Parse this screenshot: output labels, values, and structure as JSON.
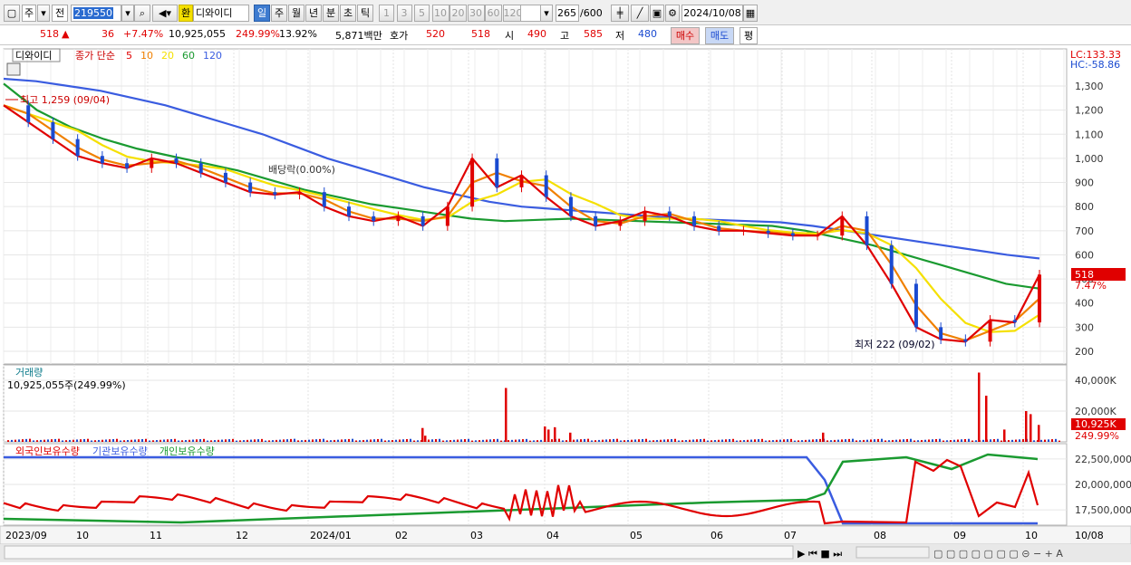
{
  "toolbar": {
    "market": "주",
    "market2": "전",
    "code": "219550",
    "stock_badge": "환",
    "stock_name": "디와이디",
    "periods": [
      "일",
      "주",
      "월",
      "년",
      "분",
      "초",
      "틱"
    ],
    "active_period": "일",
    "intervals": [
      "1",
      "3",
      "5",
      "10",
      "20",
      "30",
      "60",
      "120"
    ],
    "count": "265",
    "count_max": "/600",
    "date": "2024/10/08"
  },
  "quote": {
    "price": "518",
    "change_arrow": "▲",
    "change": "36",
    "change_pct": "+7.47%",
    "volume": "10,925,055",
    "volume_ratio": "249.99%",
    "turnover": "13.92%",
    "amount": "5,871백만",
    "bid_label": "호가",
    "bid1": "520",
    "bid2": "518",
    "open_label": "시",
    "open": "490",
    "high_label": "고",
    "high": "585",
    "low_label": "저",
    "low": "480",
    "buy_button": "매수",
    "sell_button": "매도",
    "eval_button": "평"
  },
  "price_panel": {
    "stock_label": "디와이디",
    "ma_label": "종가 단순",
    "ma_periods": [
      "5",
      "10",
      "20",
      "60",
      "120"
    ],
    "ma_colors": [
      "#e00000",
      "#f08000",
      "#f5e000",
      "#1a9a30",
      "#3a5ce0"
    ],
    "lc": "LC:133.33",
    "hc": "HC:-58.86",
    "high_annot": "최고 1,259 (09/04)",
    "low_annot": "최저 222 (09/02)",
    "dividend_annot": "배당락(0.00%)",
    "current_price": "518",
    "current_pct": "7.47%",
    "y_ticks": [
      "1,300",
      "1,200",
      "1,100",
      "1,000",
      "900",
      "800",
      "700",
      "600",
      "500",
      "400",
      "300",
      "200"
    ]
  },
  "volume_panel": {
    "title": "거래량",
    "value": "10,925,055주(249.99%)",
    "y_ticks": [
      "40,000K",
      "20,000K"
    ],
    "current": "10,925K",
    "current_pct": "249.99%"
  },
  "holdings_panel": {
    "legend": [
      "외국인보유수량",
      "기관보유수량",
      "개인보유수량"
    ],
    "colors": [
      "#e00000",
      "#3a5ce0",
      "#1a9a30"
    ],
    "y_ticks": [
      "22,500,000",
      "20,000,000",
      "17,500,000"
    ]
  },
  "x_axis": [
    "2023/09",
    "10",
    "11",
    "12",
    "2024/01",
    "02",
    "03",
    "04",
    "05",
    "06",
    "07",
    "08",
    "09",
    "10",
    "10/08"
  ],
  "chart_data": {
    "type": "line",
    "title": "디와이디",
    "series": [
      {
        "name": "종가",
        "values": [
          1220,
          1150,
          1080,
          1010,
          980,
          960,
          1000,
          980,
          940,
          900,
          860,
          850,
          860,
          800,
          760,
          740,
          760,
          720,
          800,
          1000,
          880,
          930,
          840,
          760,
          720,
          740,
          780,
          760,
          720,
          700,
          700,
          690,
          680,
          680,
          760,
          640,
          480,
          300,
          250,
          240,
          330,
          320,
          518
        ]
      },
      {
        "name": "120",
        "values": [
          1330,
          1320,
          1300,
          1280,
          1250,
          1220,
          1180,
          1140,
          1100,
          1050,
          1000,
          960,
          920,
          880,
          850,
          820,
          800,
          790,
          780,
          770,
          760,
          750,
          745,
          740,
          735,
          720,
          700,
          680,
          660,
          640,
          620,
          600,
          585
        ]
      },
      {
        "name": "60",
        "values": [
          1310,
          1200,
          1130,
          1080,
          1040,
          1010,
          980,
          950,
          910,
          870,
          840,
          810,
          790,
          770,
          750,
          740,
          745,
          750,
          745,
          740,
          735,
          730,
          725,
          720,
          700,
          670,
          640,
          600,
          560,
          520,
          480,
          460
        ]
      }
    ],
    "ylim": [
      200,
      1350
    ],
    "x": [
      "2023/09",
      "10",
      "11",
      "12",
      "2024/01",
      "02",
      "03",
      "04",
      "05",
      "06",
      "07",
      "08",
      "09",
      "10"
    ]
  }
}
